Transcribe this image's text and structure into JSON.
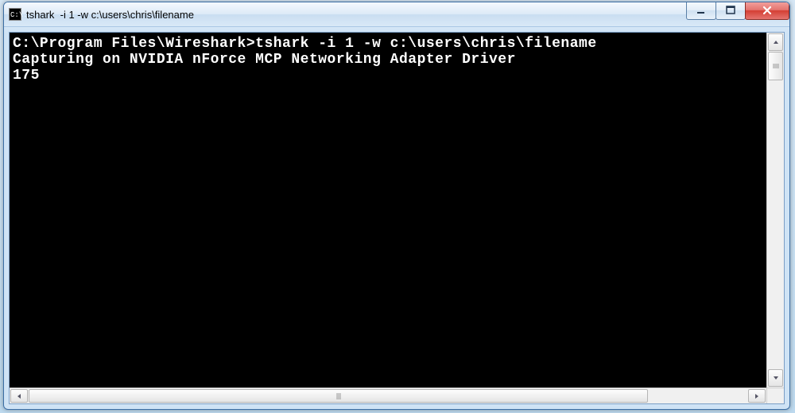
{
  "window": {
    "icon_text": "C:\\.",
    "title": "tshark  -i 1 -w c:\\users\\chris\\filename"
  },
  "terminal": {
    "line1": "C:\\Program Files\\Wireshark>tshark -i 1 -w c:\\users\\chris\\filename",
    "line2": "Capturing on NVIDIA nForce MCP Networking Adapter Driver",
    "line3": "175"
  }
}
